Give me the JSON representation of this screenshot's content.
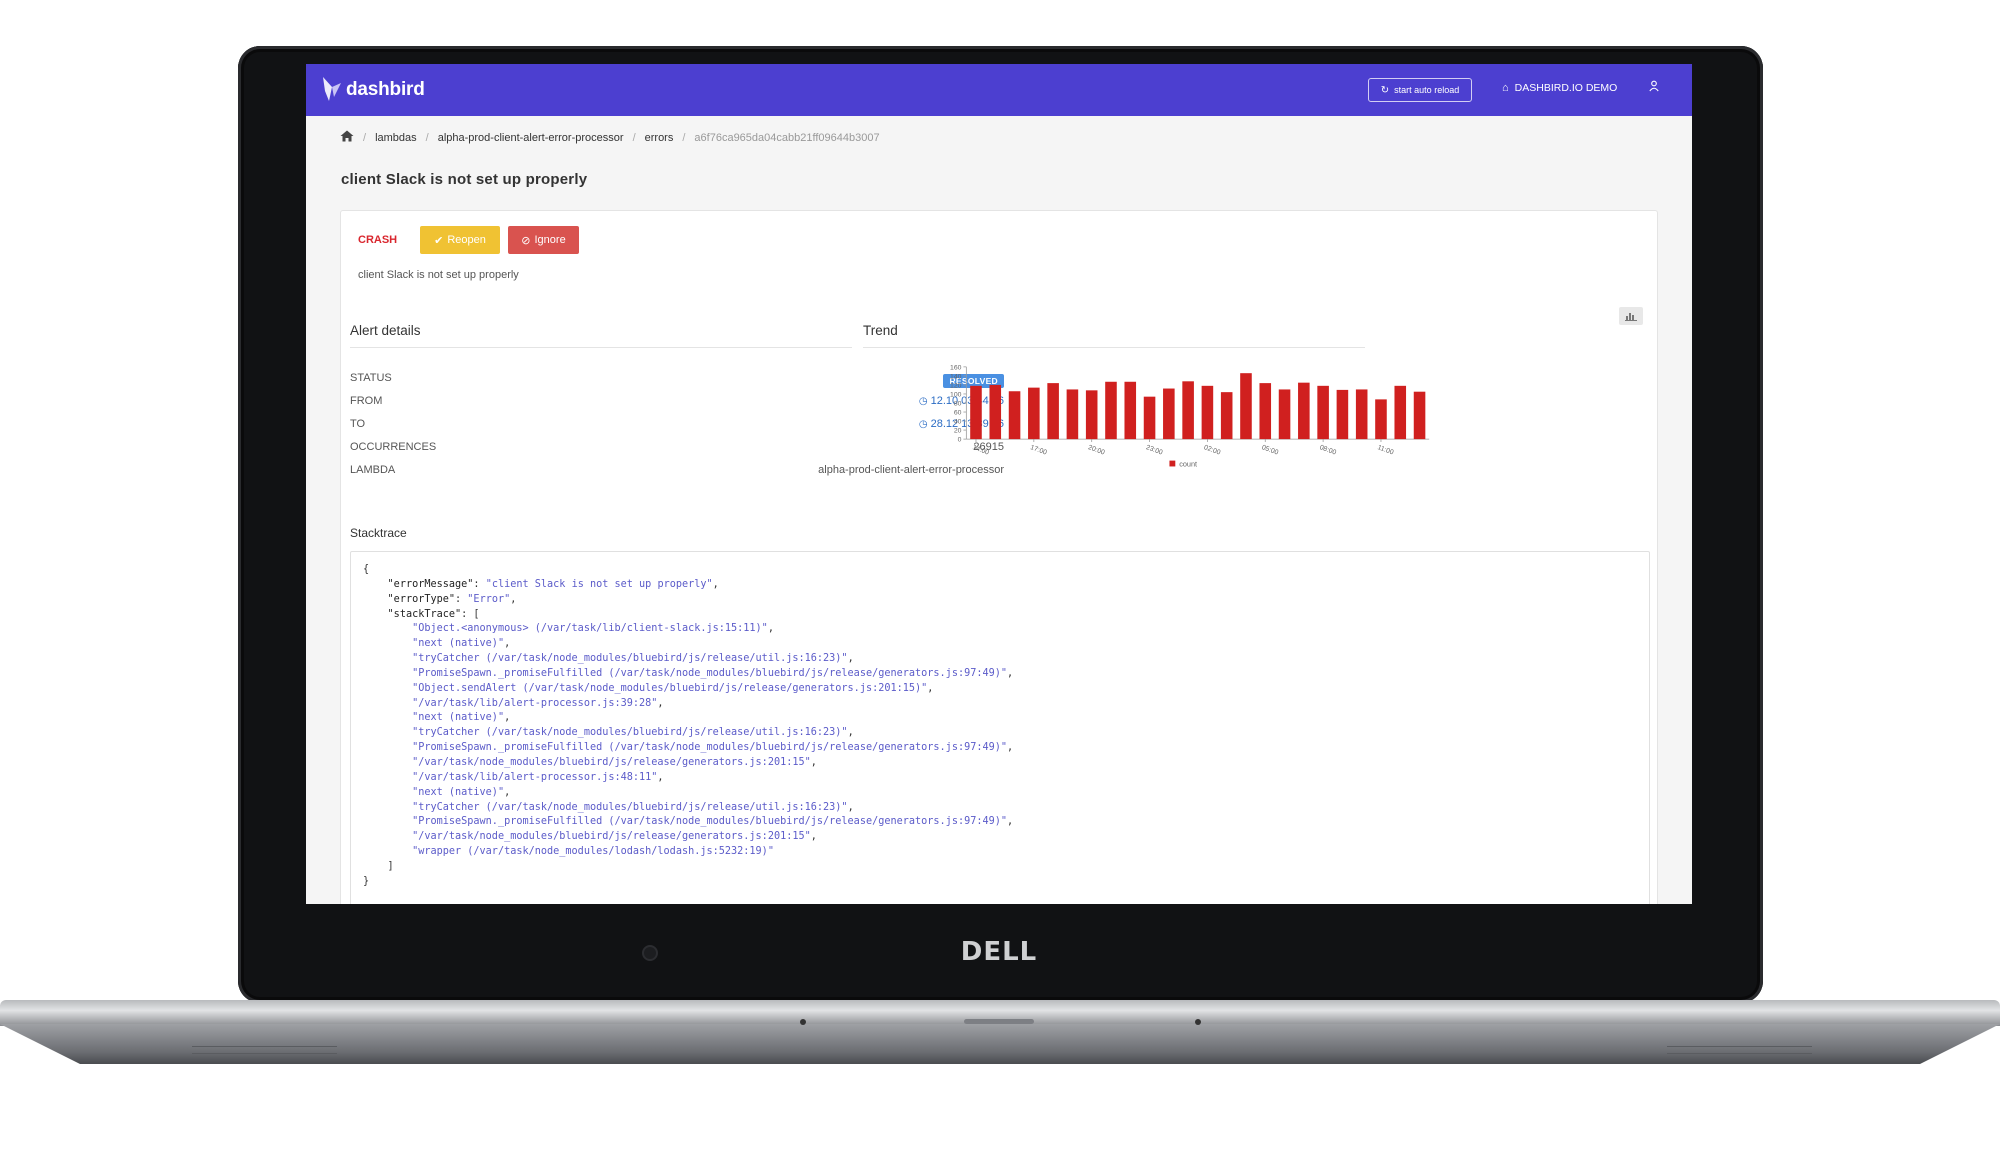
{
  "header": {
    "logo_text": "dashbird",
    "reload_button": "start auto reload",
    "demo_link": "DASHBIRD.IO DEMO"
  },
  "breadcrumb": {
    "items": [
      "lambdas",
      "alpha-prod-client-alert-error-processor",
      "errors"
    ],
    "current": "a6f76ca965da04cabb21ff09644b3007"
  },
  "page": {
    "title": "client Slack is not set up properly"
  },
  "error": {
    "type_label": "CRASH",
    "reopen_label": "Reopen",
    "ignore_label": "Ignore",
    "description": "client Slack is not set up properly"
  },
  "alert_details": {
    "title": "Alert details",
    "rows": [
      {
        "label": "STATUS",
        "value": "RESOLVED"
      },
      {
        "label": "FROM",
        "value": "12.10 03:44:26"
      },
      {
        "label": "TO",
        "value": "28.12 13:39:46"
      },
      {
        "label": "OCCURRENCES",
        "value": "26915"
      },
      {
        "label": "LAMBDA",
        "value": "alpha-prod-client-alert-error-processor"
      }
    ]
  },
  "trend": {
    "title": "Trend"
  },
  "chart_data": {
    "type": "bar",
    "title": "",
    "xlabel": "",
    "ylabel": "",
    "ylim": [
      0,
      160
    ],
    "yticks": [
      0,
      20,
      40,
      60,
      80,
      100,
      120,
      140,
      160
    ],
    "xtick_labels": [
      "14:00",
      "17:00",
      "20:00",
      "23:00",
      "02:00",
      "05:00",
      "08:00",
      "11:00"
    ],
    "series": [
      {
        "name": "count",
        "color": "#d0201f",
        "values": [
          118,
          120,
          106,
          114,
          124,
          110,
          108,
          127,
          127,
          94,
          112,
          128,
          118,
          104,
          146,
          124,
          110,
          125,
          118,
          109,
          110,
          88,
          118,
          105
        ]
      }
    ],
    "legend_position": "bottom"
  },
  "stacktrace": {
    "title": "Stacktrace",
    "errorMessage": "\"client Slack is not set up properly\"",
    "errorType": "\"Error\"",
    "frames": [
      "\"Object.<anonymous> (/var/task/lib/client-slack.js:15:11)\"",
      "\"next (native)\"",
      "\"tryCatcher (/var/task/node_modules/bluebird/js/release/util.js:16:23)\"",
      "\"PromiseSpawn._promiseFulfilled (/var/task/node_modules/bluebird/js/release/generators.js:97:49)\"",
      "\"Object.sendAlert (/var/task/node_modules/bluebird/js/release/generators.js:201:15)\"",
      "\"/var/task/lib/alert-processor.js:39:28\"",
      "\"next (native)\"",
      "\"tryCatcher (/var/task/node_modules/bluebird/js/release/util.js:16:23)\"",
      "\"PromiseSpawn._promiseFulfilled (/var/task/node_modules/bluebird/js/release/generators.js:97:49)\"",
      "\"/var/task/node_modules/bluebird/js/release/generators.js:201:15\"",
      "\"/var/task/lib/alert-processor.js:48:11\"",
      "\"next (native)\"",
      "\"tryCatcher (/var/task/node_modules/bluebird/js/release/util.js:16:23)\"",
      "\"PromiseSpawn._promiseFulfilled (/var/task/node_modules/bluebird/js/release/generators.js:97:49)\"",
      "\"/var/task/node_modules/bluebird/js/release/generators.js:201:15\"",
      "\"wrapper (/var/task/node_modules/lodash/lodash.js:5232:19)\""
    ]
  },
  "device": {
    "brand": "DELL"
  },
  "icons": [
    "home-icon",
    "reload-icon",
    "demo-home-icon",
    "user-icon",
    "check-icon",
    "ban-icon",
    "clock-icon",
    "bar-chart-icon"
  ]
}
